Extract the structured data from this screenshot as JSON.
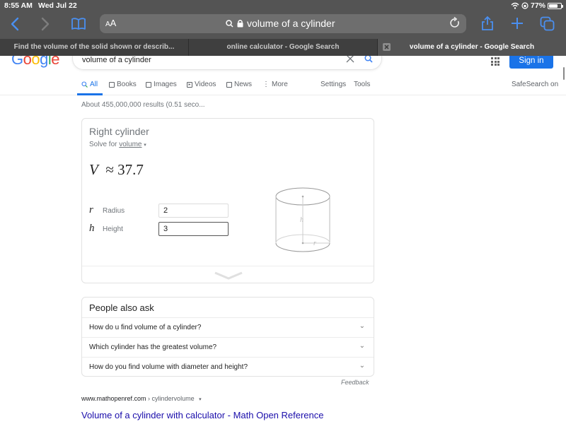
{
  "status_bar": {
    "time": "8:55 AM",
    "date": "Wed Jul 22",
    "battery": "77%",
    "battery_level": 0.77
  },
  "browser": {
    "text_size_label_small": "A",
    "text_size_label_large": "A",
    "address": "volume of a cylinder",
    "icons": {
      "back": "chevron-left-icon",
      "forward": "chevron-right-icon",
      "bookmarks": "book-icon",
      "search": "search-icon",
      "lock": "lock-icon",
      "reload": "reload-icon",
      "share": "share-icon",
      "new_tab": "plus-icon",
      "tabs": "tabs-icon"
    },
    "tabs": [
      {
        "title": "Find the volume of the solid shown or describ...",
        "active": false
      },
      {
        "title": "online calculator - Google Search",
        "active": false
      },
      {
        "title": "volume of a cylinder - Google Search",
        "active": true
      }
    ]
  },
  "google": {
    "logo": [
      "G",
      "o",
      "o",
      "g",
      "l",
      "e"
    ],
    "logo_colors": [
      "#4285f4",
      "#ea4335",
      "#fbbc05",
      "#4285f4",
      "#34a853",
      "#ea4335"
    ],
    "query": "volume of a cylinder",
    "sign_in": "Sign in",
    "nav": {
      "all": "All",
      "books": "Books",
      "images": "Images",
      "videos": "Videos",
      "news": "News",
      "more": "More",
      "settings": "Settings",
      "tools": "Tools",
      "safesearch": "SafeSearch on"
    },
    "results_stats": "About 455,000,000 results (0.51 seco..."
  },
  "calculator": {
    "title": "Right cylinder",
    "solve_prefix": "Solve for ",
    "solve_target": "volume",
    "result_var": "V",
    "result_op": "≈",
    "result_value": "37.7",
    "inputs": [
      {
        "symbol": "r",
        "label": "Radius",
        "value": "2"
      },
      {
        "symbol": "h",
        "label": "Height",
        "value": "3"
      }
    ],
    "diagram_labels": {
      "height": "h",
      "radius": "r"
    }
  },
  "people_also_ask": {
    "header": "People also ask",
    "questions": [
      "How do u find volume of a cylinder?",
      "Which cylinder has the greatest volume?",
      "How do you find volume with diameter and height?"
    ],
    "feedback": "Feedback"
  },
  "result": {
    "domain": "www.mathopenref.com",
    "separator": " › ",
    "path": "cylindervolume",
    "dropdown": "▾",
    "title": "Volume of a cylinder with calculator - Math Open Reference"
  }
}
